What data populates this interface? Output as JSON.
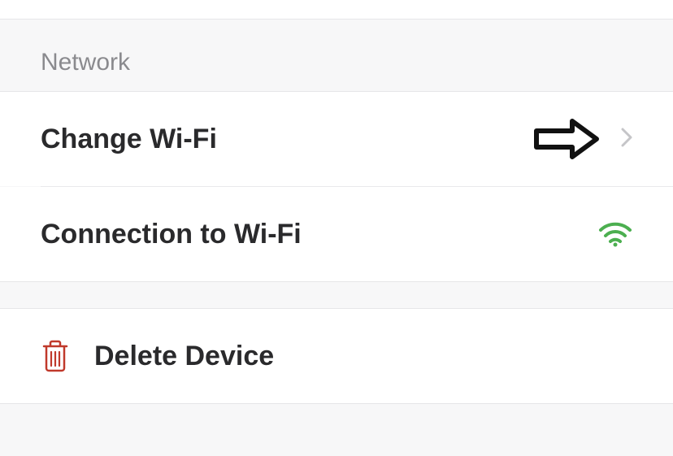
{
  "sections": {
    "network": {
      "header": "Network",
      "change_wifi": "Change Wi-Fi",
      "connection_status": "Connection to Wi-Fi"
    },
    "delete": {
      "label": "Delete Device"
    }
  },
  "colors": {
    "wifi_connected": "#4caf50",
    "danger": "#c0392b"
  }
}
